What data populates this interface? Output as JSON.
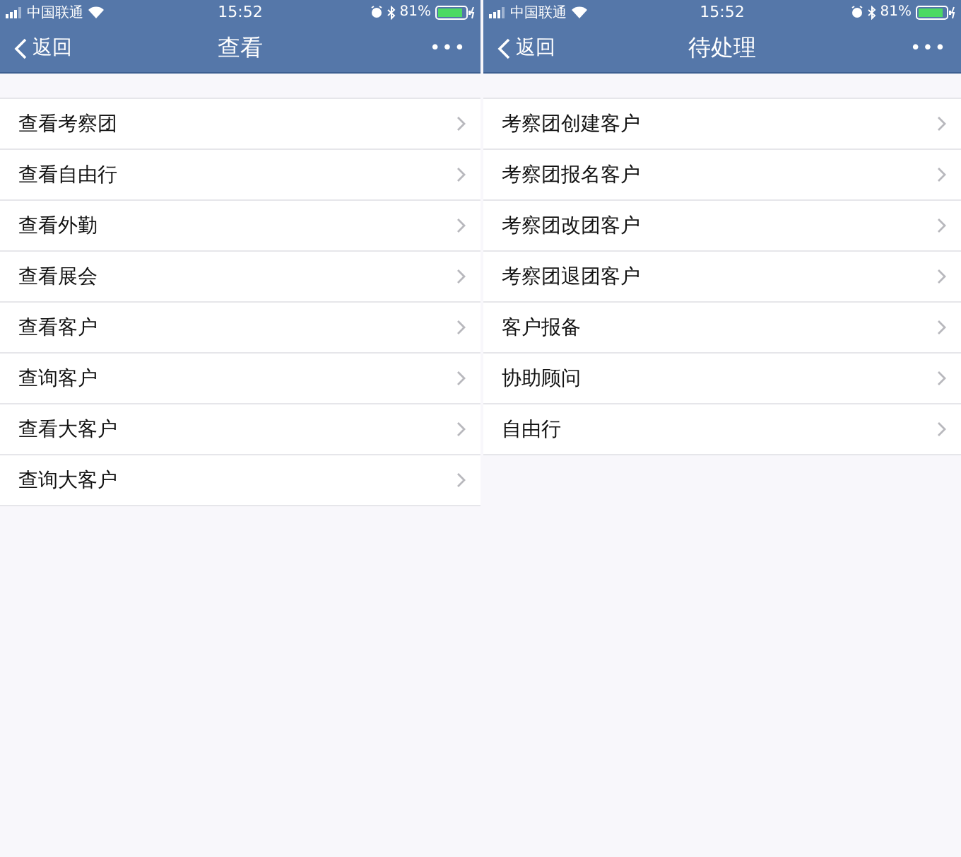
{
  "screens": [
    {
      "status_bar": {
        "carrier": "中国联通",
        "time": "15:52",
        "battery": "81%"
      },
      "nav_bar": {
        "back": "返回",
        "title": "查看",
        "more": "•••"
      },
      "items": [
        {
          "label": "查看考察团"
        },
        {
          "label": "查看自由行"
        },
        {
          "label": "查看外勤"
        },
        {
          "label": "查看展会"
        },
        {
          "label": "查看客户"
        },
        {
          "label": "查询客户"
        },
        {
          "label": "查看大客户"
        },
        {
          "label": "查询大客户"
        }
      ]
    },
    {
      "status_bar": {
        "carrier": "中国联通",
        "time": "15:52",
        "battery": "81%"
      },
      "nav_bar": {
        "back": "返回",
        "title": "待处理",
        "more": "•••"
      },
      "items": [
        {
          "label": "考察团创建客户"
        },
        {
          "label": "考察团报名客户"
        },
        {
          "label": "考察团改团客户"
        },
        {
          "label": "考察团退团客户"
        },
        {
          "label": "客户报备"
        },
        {
          "label": "协助顾问"
        },
        {
          "label": "自由行"
        }
      ]
    }
  ]
}
